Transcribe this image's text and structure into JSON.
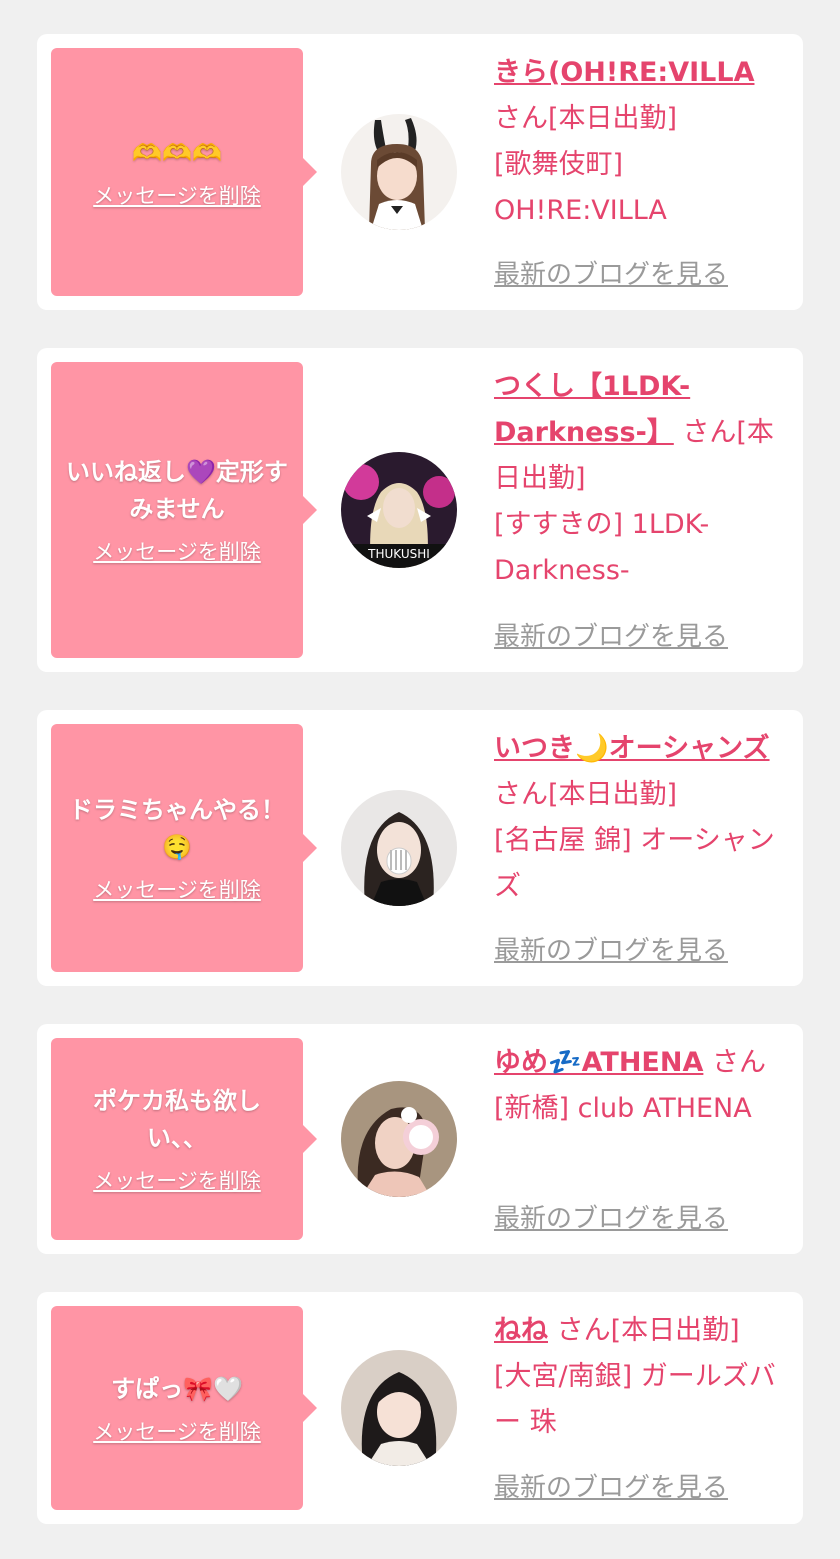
{
  "colors": {
    "page_bg": "#f0f0f0",
    "card_bg": "#ffffff",
    "bubble_bg": "#ff95a5",
    "name_text": "#e5446d",
    "blog_link": "#9a9a9a"
  },
  "delete_label": "メッセージを削除",
  "blog_label": "最新のブログを見る",
  "entries": [
    {
      "message": "🫶🫶🫶",
      "name": "きら(OH!RE:VILLA",
      "suffix": "さん[本日出勤]",
      "shop": "[歌舞伎町] OH!RE:VILLA",
      "avatar": "bunny-ears-girl-avatar"
    },
    {
      "message": "いいね返し💜定形すみません",
      "name": "つくし【1LDK-Darkness-】",
      "suffix": "さん[本日出勤]",
      "shop": "[すすきの] 1LDK-Darkness-",
      "avatar": "tsukushi-avatar"
    },
    {
      "message": "ドラミちゃんやる！🤤",
      "name": "いつき🌙オーシャンズ",
      "suffix": "さん[本日出勤]",
      "shop": "[名古屋 錦] オーシャンズ",
      "avatar": "itsuki-avatar"
    },
    {
      "message": "ポケカ私も欲しい、、",
      "name": "ゆめ💤ATHENA",
      "suffix": "さん",
      "shop": "[新橋] club ATHENA",
      "avatar": "yume-avatar"
    },
    {
      "message": "すぱっ🎀🤍",
      "name": "ねね",
      "suffix": "さん[本日出勤]",
      "shop": "[大宮/南銀] ガールズバー 珠",
      "avatar": "nene-avatar"
    }
  ]
}
